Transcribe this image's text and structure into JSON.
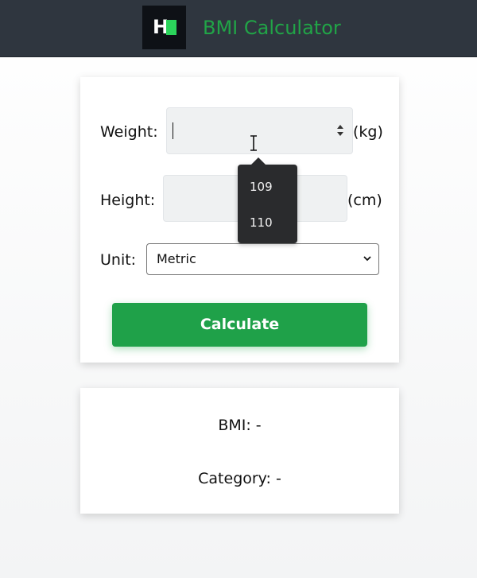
{
  "header": {
    "logo_letter": "H",
    "title": "BMI Calculator"
  },
  "form": {
    "weight_label": "Weight:",
    "weight_value": "",
    "weight_unit": "(kg)",
    "height_label": "Height:",
    "height_value": "",
    "height_unit": "(cm)",
    "unit_label": "Unit:",
    "unit_selected": "Metric",
    "calculate_label": "Calculate"
  },
  "autocomplete": {
    "items": [
      "109",
      "110"
    ]
  },
  "result": {
    "bmi": "BMI: -",
    "category": "Category: -"
  },
  "colors": {
    "header_bg": "#2f363f",
    "brand_green": "#21a447",
    "button_green": "#1fa149",
    "logo_block": "#2bd45b"
  },
  "icons": {
    "number_spinner": "spinner-arrows-icon",
    "text_cursor": "i-beam-cursor-icon",
    "select_chevron": "chevron-down-icon"
  }
}
